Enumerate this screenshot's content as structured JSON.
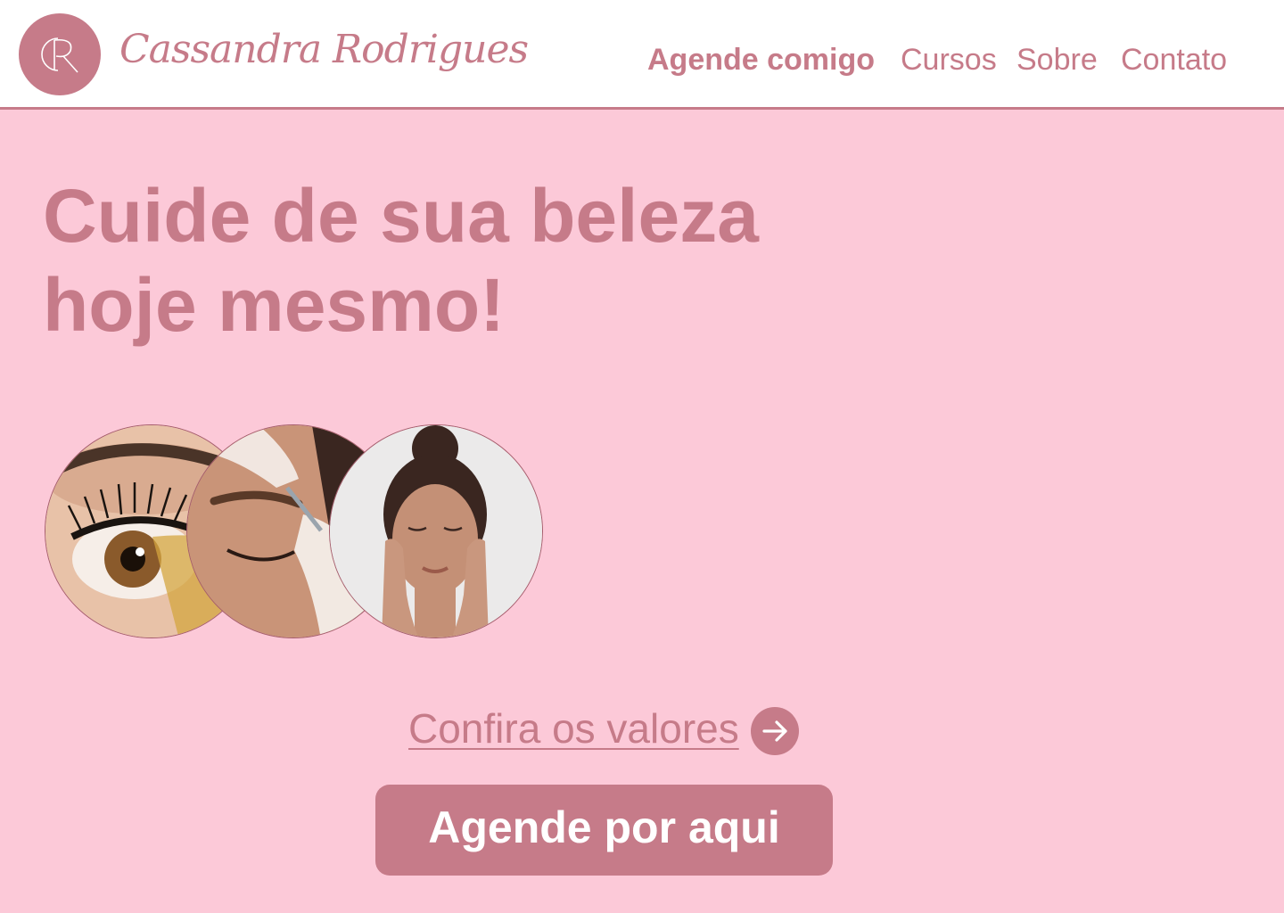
{
  "header": {
    "logo_monogram": "CR",
    "brand_name": "Cassandra Rodrigues",
    "nav": [
      {
        "label": "Agende comigo",
        "active": true
      },
      {
        "label": "Cursos"
      },
      {
        "label": "Sobre"
      },
      {
        "label": "Contato"
      }
    ]
  },
  "hero": {
    "headline_line1": "Cuide de sua beleza",
    "headline_line2": "hoje mesmo!",
    "photos": [
      {
        "subject": "eye-lashes-glitter-makeup"
      },
      {
        "subject": "eyebrow-design-treatment"
      },
      {
        "subject": "woman-facial-skincare"
      }
    ],
    "prices_link": "Confira os valores",
    "arrow_icon": "arrow-right-icon",
    "cta_label": "Agende por aqui"
  },
  "colors": {
    "accent": "#c67b89",
    "background": "#fcc9d8",
    "header_bg": "#ffffff",
    "button_text": "#ffffff"
  }
}
